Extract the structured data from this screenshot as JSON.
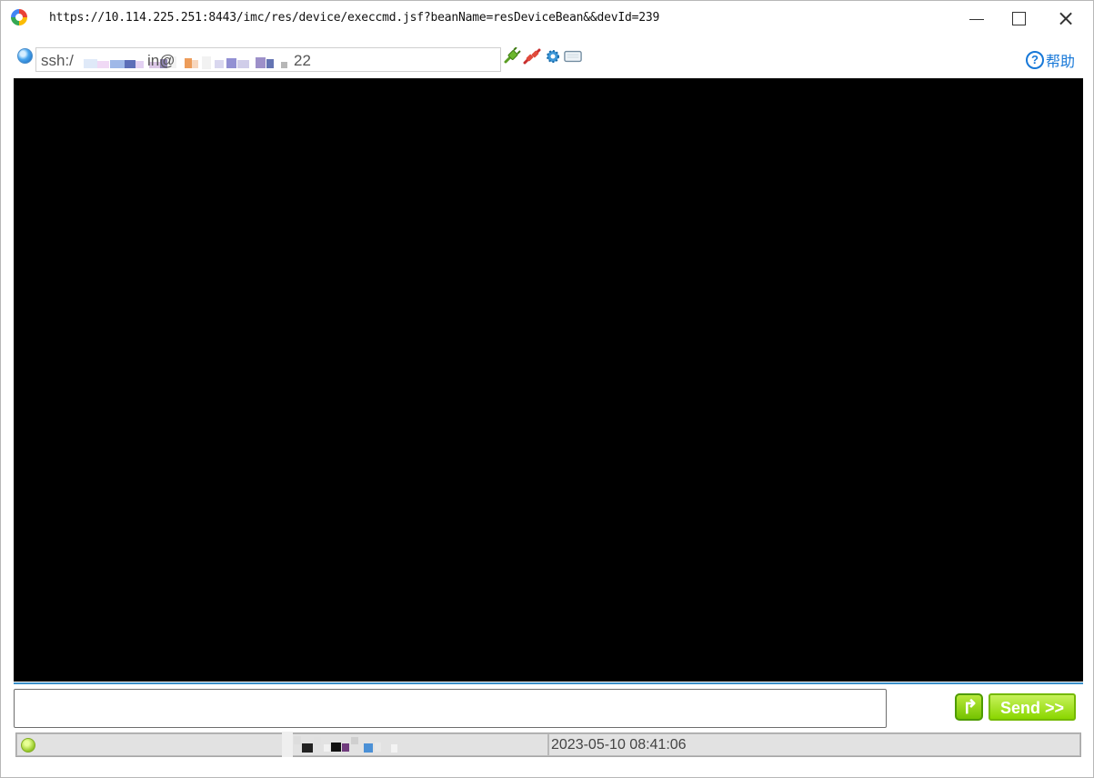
{
  "titlebar": {
    "url": "https://10.114.225.251:8443/imc/res/device/execcmd.jsf?beanName=resDeviceBean&&devId=239"
  },
  "toolbar": {
    "address_prefix": "ssh:/",
    "address_mid": "in@",
    "address_suffix": "22",
    "help_label": "帮助"
  },
  "actions": {
    "send_label": "Send >>"
  },
  "status": {
    "timestamp": "2023-05-10 08:41:06"
  },
  "colors": {
    "accent": "#1778d8",
    "send_green": "#8ad600",
    "terminal_bg": "#000000"
  }
}
